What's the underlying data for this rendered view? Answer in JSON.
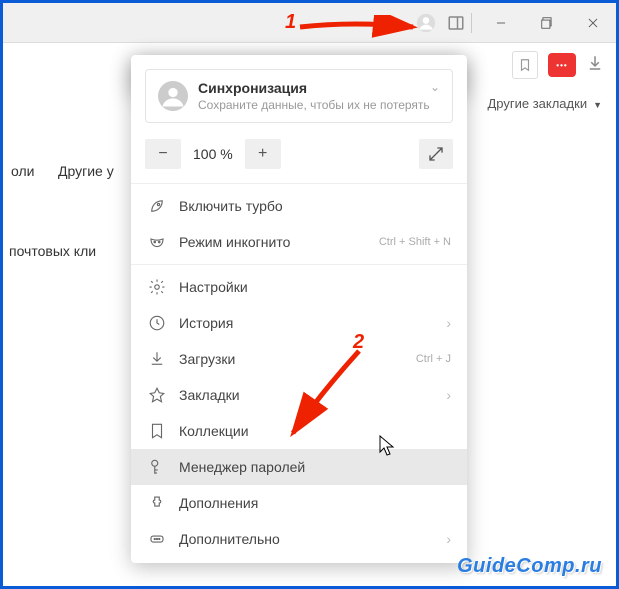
{
  "titlebar": {
    "menu_active": true
  },
  "toolbar": {
    "badge_text": "•••",
    "other_bookmarks": "Другие закладки"
  },
  "background": {
    "text1": "оли",
    "text2": "Другие у",
    "text3": "почтовых кли"
  },
  "menu": {
    "sync": {
      "title": "Синхронизация",
      "subtitle": "Сохраните данные, чтобы их не потерять"
    },
    "zoom": {
      "minus": "−",
      "value": "100 %",
      "plus": "+"
    },
    "items": [
      {
        "label": "Включить турбо"
      },
      {
        "label": "Режим инкогнито",
        "shortcut": "Ctrl + Shift + N"
      }
    ],
    "items2": [
      {
        "label": "Настройки"
      },
      {
        "label": "История",
        "chevron": true
      },
      {
        "label": "Загрузки",
        "shortcut": "Ctrl + J"
      },
      {
        "label": "Закладки",
        "chevron": true
      },
      {
        "label": "Коллекции"
      },
      {
        "label": "Менеджер паролей",
        "highlight": true
      },
      {
        "label": "Дополнения"
      },
      {
        "label": "Дополнительно",
        "chevron": true
      }
    ]
  },
  "annotations": {
    "num1": "1",
    "num2": "2"
  },
  "watermark": {
    "text": "GuideComp.ru"
  }
}
